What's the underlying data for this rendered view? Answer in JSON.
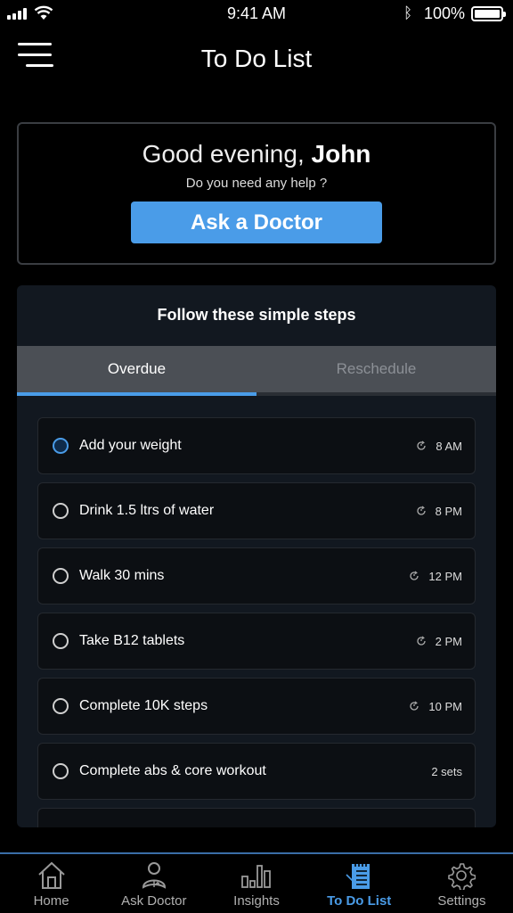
{
  "status_bar": {
    "time": "9:41 AM",
    "battery": "100%"
  },
  "header": {
    "title": "To Do List"
  },
  "greeting": {
    "salutation": "Good evening,",
    "name": "John",
    "subtitle": "Do you need any help ?",
    "button_label": "Ask a Doctor"
  },
  "steps": {
    "title": "Follow these simple steps",
    "tabs": [
      {
        "label": "Overdue",
        "active": true
      },
      {
        "label": "Reschedule",
        "active": false
      }
    ],
    "items": [
      {
        "label": "Add your weight",
        "meta": "8 AM",
        "icon": "clock-icon",
        "selected": true
      },
      {
        "label": "Drink 1.5 ltrs of water",
        "meta": "8 PM",
        "icon": "clock-icon",
        "selected": false
      },
      {
        "label": "Walk 30 mins",
        "meta": "12 PM",
        "icon": "clock-icon",
        "selected": false
      },
      {
        "label": "Take B12 tablets",
        "meta": "2 PM",
        "icon": "clock-icon",
        "selected": false
      },
      {
        "label": "Complete 10K steps",
        "meta": "10 PM",
        "icon": "clock-icon",
        "selected": false
      },
      {
        "label": "Complete abs & core workout",
        "meta": "2 sets",
        "icon": null,
        "selected": false
      },
      {
        "label": "",
        "meta": "",
        "icon": null,
        "selected": false
      }
    ]
  },
  "nav": {
    "items": [
      {
        "label": "Home",
        "icon": "home-icon",
        "active": false
      },
      {
        "label": "Ask Doctor",
        "icon": "doctor-icon",
        "active": false
      },
      {
        "label": "Insights",
        "icon": "bar-chart-icon",
        "active": false
      },
      {
        "label": "To Do List",
        "icon": "notepad-icon",
        "active": true
      },
      {
        "label": "Settings",
        "icon": "gear-icon",
        "active": false
      }
    ]
  },
  "colors": {
    "accent": "#4a9ce8",
    "background": "#000000",
    "card": "#121820"
  }
}
